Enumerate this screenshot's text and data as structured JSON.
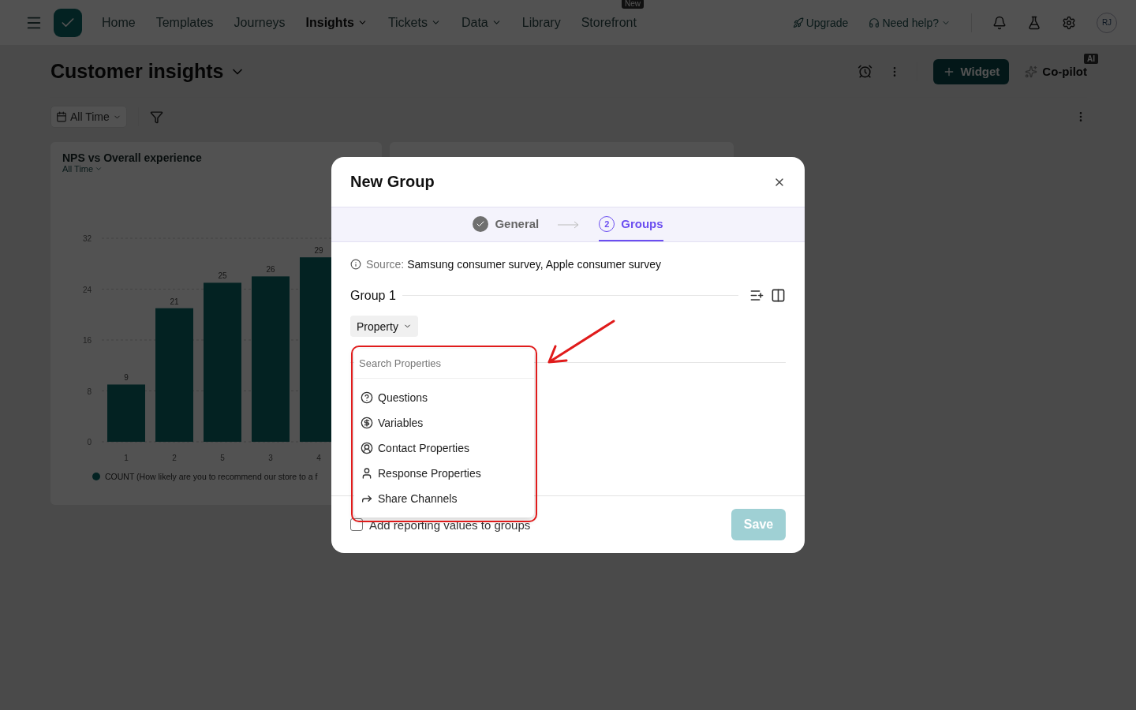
{
  "nav": {
    "items": [
      {
        "label": "Home",
        "selected": false,
        "caret": false
      },
      {
        "label": "Templates",
        "selected": false,
        "caret": false
      },
      {
        "label": "Journeys",
        "selected": false,
        "caret": false
      },
      {
        "label": "Insights",
        "selected": true,
        "caret": true
      },
      {
        "label": "Tickets",
        "selected": false,
        "caret": true
      },
      {
        "label": "Data",
        "selected": false,
        "caret": true
      },
      {
        "label": "Library",
        "selected": false,
        "caret": false
      },
      {
        "label": "Storefront",
        "selected": false,
        "caret": false,
        "badge": "New"
      }
    ],
    "upgrade": "Upgrade",
    "help": "Need help?",
    "avatar": "RJ"
  },
  "dashboard": {
    "title": "Customer insights",
    "widget_button": "Widget",
    "copilot": "Co-pilot",
    "copilot_badge": "AI",
    "date_filter": "All Time"
  },
  "card": {
    "title": "NPS vs Overall experience",
    "period": "All Time",
    "legend": "COUNT (How likely are you to recommend our store to a f",
    "chart_data": {
      "type": "bar",
      "categories": [
        "1",
        "2",
        "5",
        "3",
        "4"
      ],
      "series": [
        {
          "color": "#0b6b6b",
          "values": [
            9,
            21,
            25,
            26,
            29
          ]
        }
      ],
      "yticks": [
        0,
        8,
        16,
        24,
        32
      ],
      "ylim": [
        0,
        32
      ],
      "data_labels": true,
      "grid": true
    }
  },
  "modal": {
    "title": "New Group",
    "steps": [
      {
        "label": "General",
        "done": true,
        "selected": false
      },
      {
        "label": "Groups",
        "number": "2",
        "done": false,
        "selected": true
      }
    ],
    "source_label": "Source:",
    "source": "Samsung consumer survey, Apple consumer survey",
    "group_title": "Group 1",
    "property_button": "Property",
    "search": {
      "placeholder": "Search Properties"
    },
    "options": [
      {
        "label": "Questions",
        "kind": "question"
      },
      {
        "label": "Variables",
        "kind": "dollar"
      },
      {
        "label": "Contact Properties",
        "kind": "contact"
      },
      {
        "label": "Response Properties",
        "kind": "person"
      },
      {
        "label": "Share Channels",
        "kind": "share"
      }
    ],
    "reporting": {
      "label": "Add reporting values to groups",
      "checked": false
    },
    "save": {
      "label": "Save",
      "disabled": true
    }
  }
}
